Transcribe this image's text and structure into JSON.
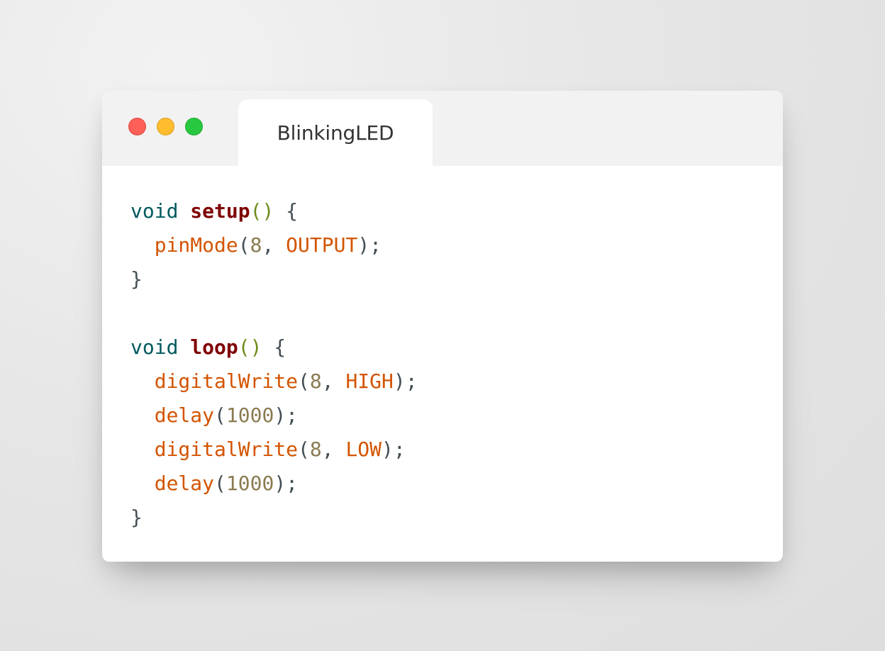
{
  "window": {
    "tab_title": "BlinkingLED",
    "controls": [
      "close",
      "minimize",
      "zoom"
    ]
  },
  "code": {
    "language": "arduino",
    "lines": [
      "void setup() {",
      "  pinMode(8, OUTPUT);",
      "}",
      "",
      "void loop() {",
      "  digitalWrite(8, HIGH);",
      "  delay(1000);",
      "  digitalWrite(8, LOW);",
      "  delay(1000);",
      "}"
    ],
    "tokens": {
      "void": "void",
      "setup": "setup",
      "loop": "loop",
      "parens": "()",
      "open_brace": " {",
      "close_brace": "}",
      "pinMode": "pinMode",
      "digitalWrite": "digitalWrite",
      "delay": "delay",
      "pin": "8",
      "output": "OUTPUT",
      "high": "HIGH",
      "low": "LOW",
      "ms": "1000"
    }
  },
  "colors": {
    "close": "#fe5f57",
    "minimize": "#febc2e",
    "zoom": "#28c840",
    "type_keyword": "#00595f",
    "function_name": "#7f0000",
    "parens": "#6c8c1b",
    "builtin_call": "#d35400",
    "number": "#8a7b52",
    "text": "#434f54"
  }
}
